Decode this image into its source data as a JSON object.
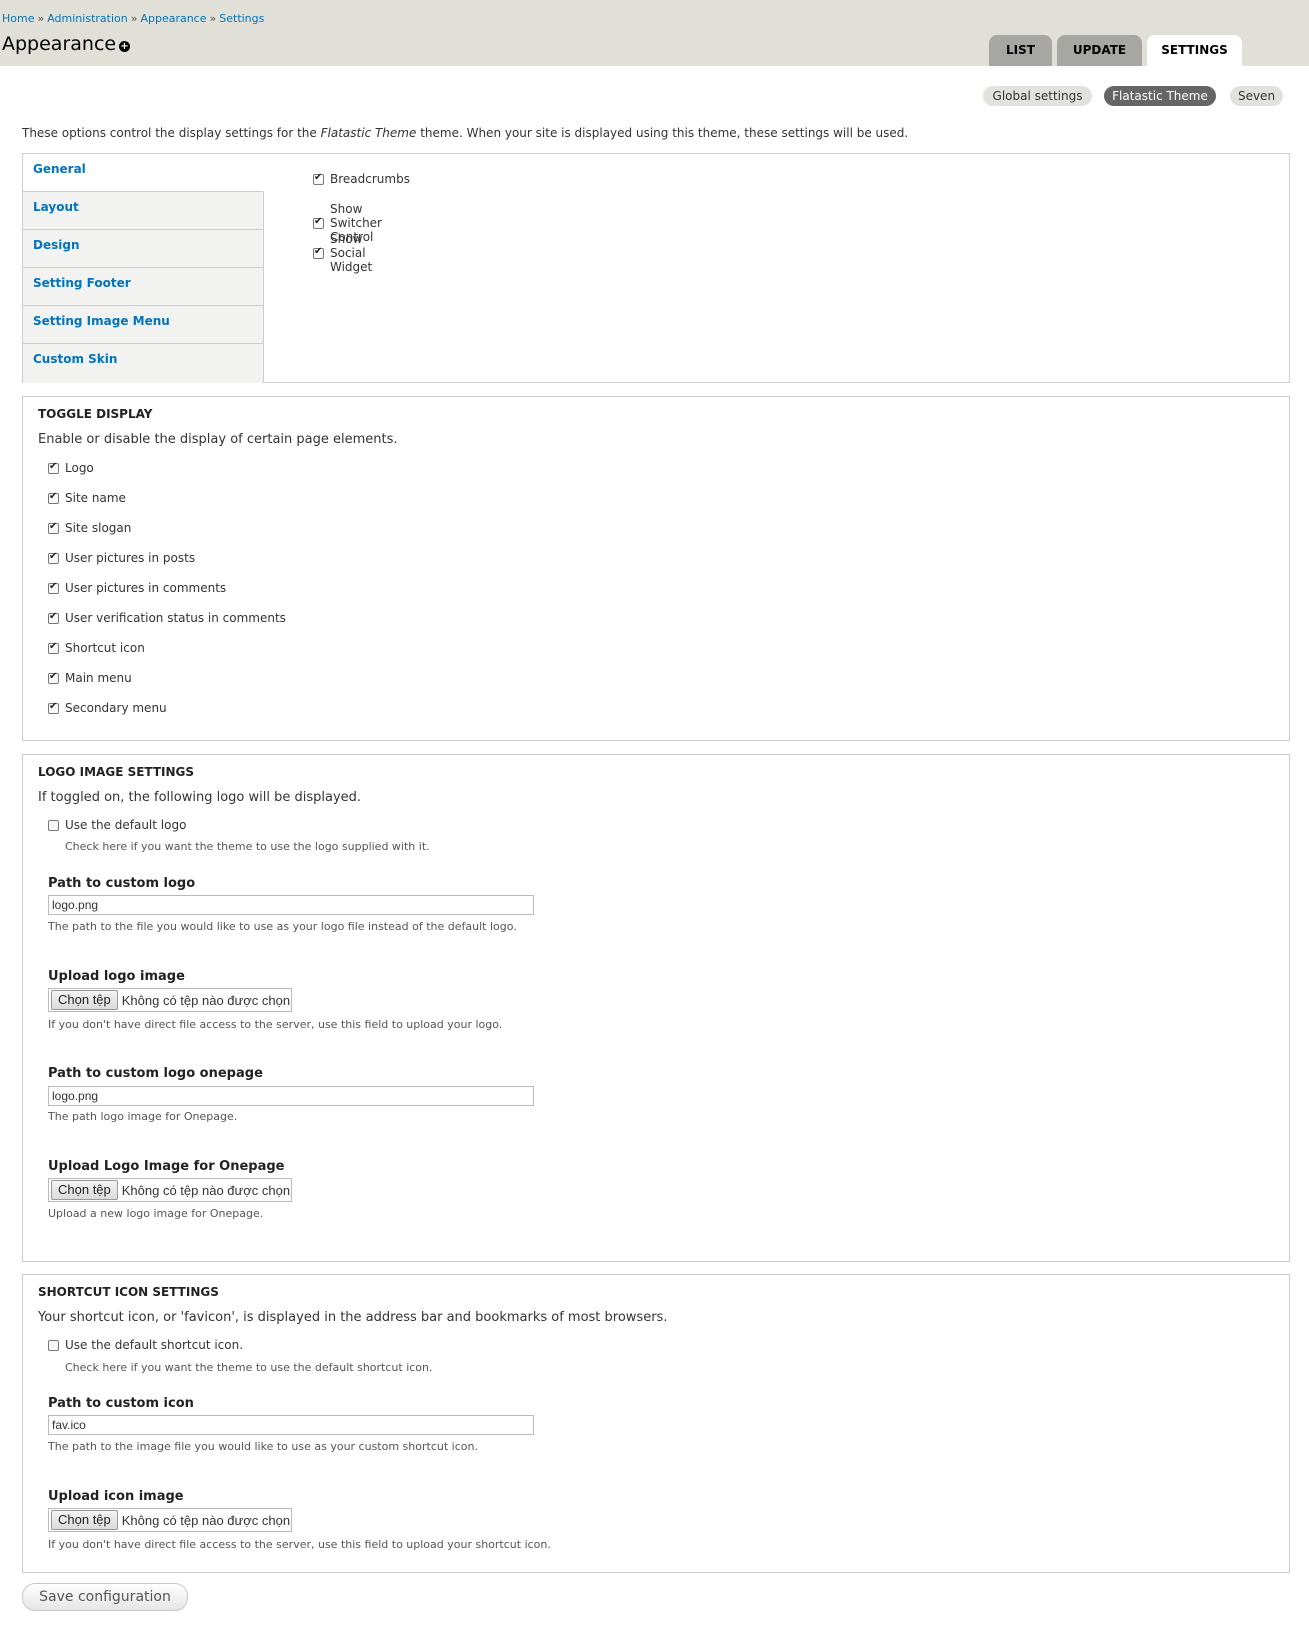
{
  "breadcrumb": [
    "Home",
    "Administration",
    "Appearance",
    "Settings"
  ],
  "breadcrumb_sep": "»",
  "page_title": "Appearance",
  "primary_tabs": [
    "LIST",
    "UPDATE",
    "SETTINGS"
  ],
  "primary_active": "SETTINGS",
  "secondary_tabs": [
    "Global settings",
    "Flatastic Theme",
    "Seven"
  ],
  "secondary_active": "Flatastic Theme",
  "intro": {
    "before": "These options control the display settings for the ",
    "theme": "Flatastic Theme",
    "after": " theme. When your site is displayed using this theme, these settings will be used."
  },
  "vertical_tabs": [
    "General",
    "Layout",
    "Design",
    "Setting Footer",
    "Setting Image Menu",
    "Custom Skin"
  ],
  "general_options": [
    {
      "label": "Breadcrumbs",
      "checked": true
    },
    {
      "label": "Show Switcher Control",
      "checked": true
    },
    {
      "label": "Show Social Widget",
      "checked": true
    }
  ],
  "toggle_display": {
    "legend": "TOGGLE DISPLAY",
    "description": "Enable or disable the display of certain page elements.",
    "items": [
      {
        "label": "Logo",
        "checked": true
      },
      {
        "label": "Site name",
        "checked": true
      },
      {
        "label": "Site slogan",
        "checked": true
      },
      {
        "label": "User pictures in posts",
        "checked": true
      },
      {
        "label": "User pictures in comments",
        "checked": true
      },
      {
        "label": "User verification status in comments",
        "checked": true
      },
      {
        "label": "Shortcut icon",
        "checked": true
      },
      {
        "label": "Main menu",
        "checked": true
      },
      {
        "label": "Secondary menu",
        "checked": true
      }
    ]
  },
  "logo_settings": {
    "legend": "LOGO IMAGE SETTINGS",
    "description": "If toggled on, the following logo will be displayed.",
    "default_label": "Use the default logo",
    "default_help": "Check here if you want the theme to use the logo supplied with it.",
    "path_label": "Path to custom logo",
    "path_value": "logo.png",
    "path_help": "The path to the file you would like to use as your logo file instead of the default logo.",
    "upload_label": "Upload logo image",
    "upload_help": "If you don't have direct file access to the server, use this field to upload your logo.",
    "onepage_path_label": "Path to custom logo onepage",
    "onepage_path_value": "logo.png",
    "onepage_path_help": "The path logo image for Onepage.",
    "onepage_upload_label": "Upload Logo Image for Onepage",
    "onepage_upload_help": "Upload a new logo image for Onepage."
  },
  "icon_settings": {
    "legend": "SHORTCUT ICON SETTINGS",
    "description": "Your shortcut icon, or 'favicon', is displayed in the address bar and bookmarks of most browsers.",
    "default_label": "Use the default shortcut icon.",
    "default_help": "Check here if you want the theme to use the default shortcut icon.",
    "path_label": "Path to custom icon",
    "path_value": "fav.ico",
    "path_help": "The path to the image file you would like to use as your custom shortcut icon.",
    "upload_label": "Upload icon image",
    "upload_help": "If you don't have direct file access to the server, use this field to upload your shortcut icon."
  },
  "file_button": "Chọn tệp",
  "file_none": "Không có tệp nào được chọn",
  "save_button": "Save configuration"
}
